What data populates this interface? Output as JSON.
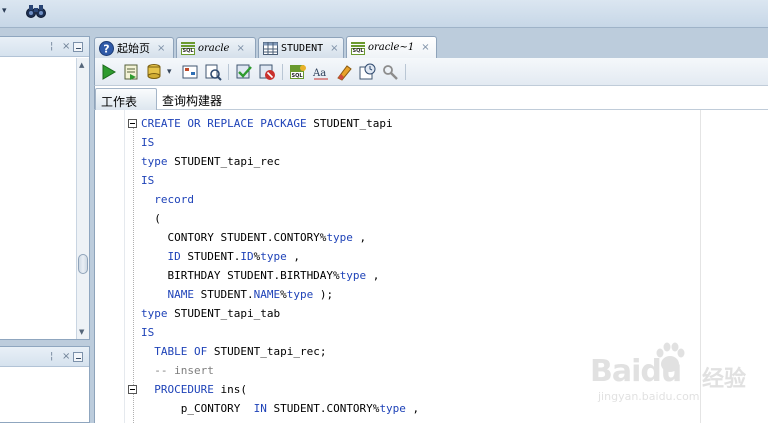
{
  "tabs": [
    {
      "label": "起始页",
      "icon": "help-icon",
      "style": "cjk",
      "active": false
    },
    {
      "label": "oracle",
      "icon": "sql-worksheet-icon",
      "style": "italic",
      "active": false
    },
    {
      "label": "STUDENT",
      "icon": "table-icon",
      "style": "plain",
      "active": false
    },
    {
      "label": "oracle~1",
      "icon": "sql-worksheet-icon",
      "style": "italic",
      "active": true
    }
  ],
  "subtabs": {
    "worksheet": "工作表",
    "query_builder": "查询构建器"
  },
  "toolbar": [
    "run-statement-icon",
    "run-script-icon",
    "commit-icon",
    "rollback-icon",
    "explain-plan-icon",
    "autotrace-icon",
    "sql-tuning-icon",
    "uppercase-icon",
    "clear-icon",
    "history-icon",
    "find-icon"
  ],
  "code_lines": [
    [
      {
        "t": "CREATE OR REPLACE PACKAGE",
        "k": "kw"
      },
      {
        "t": " STUDENT_tapi",
        "k": ""
      }
    ],
    [
      {
        "t": "IS",
        "k": "kw"
      }
    ],
    [
      {
        "t": "type",
        "k": "kw"
      },
      {
        "t": " STUDENT_tapi_rec",
        "k": ""
      }
    ],
    [
      {
        "t": "IS",
        "k": "kw"
      }
    ],
    [
      {
        "t": "  record",
        "k": "kw"
      }
    ],
    [
      {
        "t": "  (",
        "k": ""
      }
    ],
    [
      {
        "t": "    CONTORY STUDENT.CONTORY%",
        "k": ""
      },
      {
        "t": "type",
        "k": "kw"
      },
      {
        "t": " ,",
        "k": ""
      }
    ],
    [
      {
        "t": "    ID",
        "k": "kw"
      },
      {
        "t": " STUDENT.",
        "k": ""
      },
      {
        "t": "ID",
        "k": "kw"
      },
      {
        "t": "%",
        "k": ""
      },
      {
        "t": "type",
        "k": "kw"
      },
      {
        "t": " ,",
        "k": ""
      }
    ],
    [
      {
        "t": "    BIRTHDAY STUDENT.BIRTHDAY%",
        "k": ""
      },
      {
        "t": "type",
        "k": "kw"
      },
      {
        "t": " ,",
        "k": ""
      }
    ],
    [
      {
        "t": "    NAME",
        "k": "kw"
      },
      {
        "t": " STUDENT.",
        "k": ""
      },
      {
        "t": "NAME",
        "k": "kw"
      },
      {
        "t": "%",
        "k": ""
      },
      {
        "t": "type",
        "k": "kw"
      },
      {
        "t": " );",
        "k": ""
      }
    ],
    [
      {
        "t": "type",
        "k": "kw"
      },
      {
        "t": " STUDENT_tapi_tab",
        "k": ""
      }
    ],
    [
      {
        "t": "IS",
        "k": "kw"
      }
    ],
    [
      {
        "t": "  TABLE OF",
        "k": "kw"
      },
      {
        "t": " STUDENT_tapi_rec;",
        "k": ""
      }
    ],
    [
      {
        "t": "  -- insert",
        "k": "cm"
      }
    ],
    [
      {
        "t": "  PROCEDURE",
        "k": "kw"
      },
      {
        "t": " ins(",
        "k": ""
      }
    ],
    [
      {
        "t": "      p_CONTORY  ",
        "k": ""
      },
      {
        "t": "IN",
        "k": "kw"
      },
      {
        "t": " STUDENT.CONTORY%",
        "k": ""
      },
      {
        "t": "type",
        "k": "kw"
      },
      {
        "t": " ,",
        "k": ""
      }
    ]
  ],
  "watermark": {
    "brand": "Baidu",
    "cn": "经验",
    "url": "jingyan.baidu.com"
  }
}
